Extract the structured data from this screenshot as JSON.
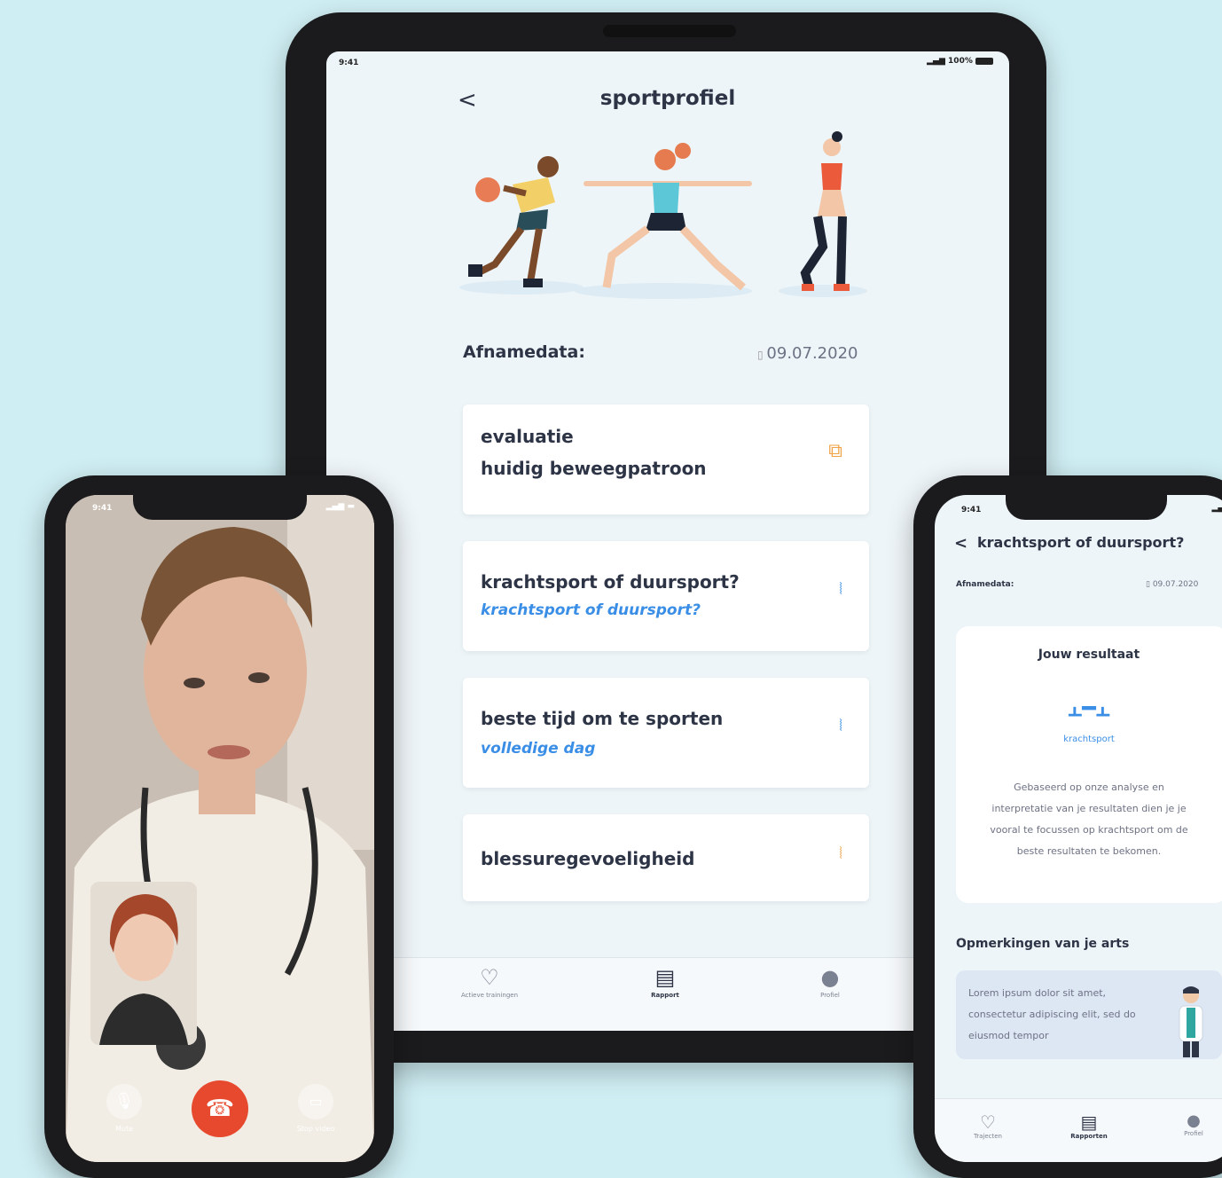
{
  "tablet": {
    "status_time": "9:41",
    "status_right": "100%",
    "back_glyph": "<",
    "title": "sportprofiel",
    "date_label": "Afnamedata:",
    "date_value": "09.07.2020",
    "cards": [
      {
        "title": "evaluatie",
        "title2": "huidig beweegpatroon",
        "subtitle": "",
        "icon": "chat-icon"
      },
      {
        "title": "krachtsport of duursport?",
        "title2": "",
        "subtitle": "krachtsport of duursport?",
        "icon": "dna-icon"
      },
      {
        "title": "beste tijd om te sporten",
        "title2": "",
        "subtitle": "volledige dag",
        "icon": "dna-icon"
      },
      {
        "title": "blessuregevoeligheid",
        "title2": "",
        "subtitle": "",
        "icon": "dna-icon"
      }
    ],
    "nav": [
      {
        "label": "Actieve trainingen",
        "icon": "heart-icon"
      },
      {
        "label": "Rapport",
        "icon": "clipboard-icon"
      },
      {
        "label": "Profiel",
        "icon": "person-icon"
      }
    ]
  },
  "left_phone": {
    "status_time": "9:41",
    "controls": [
      {
        "label": "Mute",
        "icon": "microphone-icon"
      },
      {
        "label": "",
        "icon": "hangup-icon"
      },
      {
        "label": "Stop video",
        "icon": "video-icon"
      }
    ]
  },
  "right_phone": {
    "status_time": "9:41",
    "back_glyph": "<",
    "title": "krachtsport of duursport?",
    "date_label": "Afnamedata:",
    "date_value": "09.07.2020",
    "result_title": "Jouw resultaat",
    "result_label": "krachtsport",
    "result_text": "Gebaseerd op onze analyse en interpretatie van je resultaten dien je je vooral te focussen op krachtsport om de beste resultaten te bekomen.",
    "remarks_title": "Opmerkingen van je arts",
    "remarks_text": "Lorem ipsum dolor sit amet, consectetur adipiscing elit, sed do eiusmod tempor",
    "nav": [
      {
        "label": "Trajecten",
        "icon": "heart-icon"
      },
      {
        "label": "Rapporten",
        "icon": "clipboard-icon"
      },
      {
        "label": "Profiel",
        "icon": "person-icon"
      }
    ]
  },
  "colors": {
    "background": "#cfeef3",
    "accent_blue": "#3a8ee6",
    "navy": "#2d3446",
    "orange": "#f0a246",
    "hangup_red": "#e6492d"
  }
}
